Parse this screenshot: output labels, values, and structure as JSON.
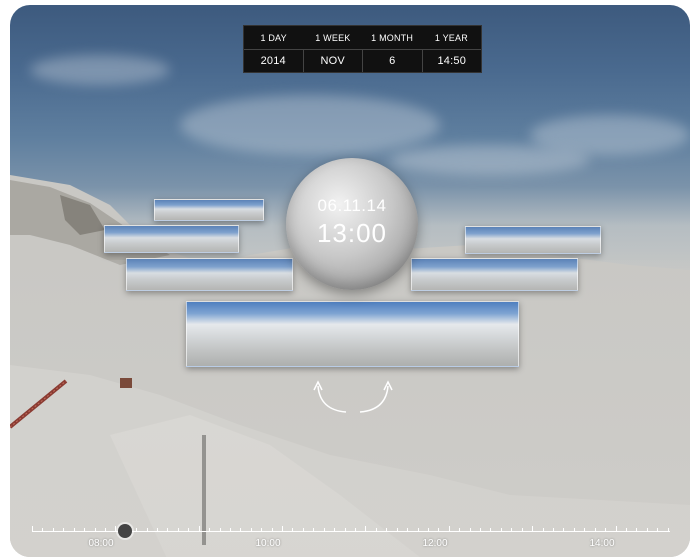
{
  "date_controls": {
    "ranges": [
      "1 DAY",
      "1 WEEK",
      "1 MONTH",
      "1 YEAR"
    ],
    "values": [
      "2014",
      "NOV",
      "6",
      "14:50"
    ]
  },
  "clock": {
    "date": "06.11.14",
    "time": "13:00"
  },
  "timeline": {
    "labels": [
      "08:00",
      "10:00",
      "12:00",
      "14:00"
    ]
  },
  "colors": {
    "control_bg": "#111111",
    "text": "#ffffff"
  }
}
